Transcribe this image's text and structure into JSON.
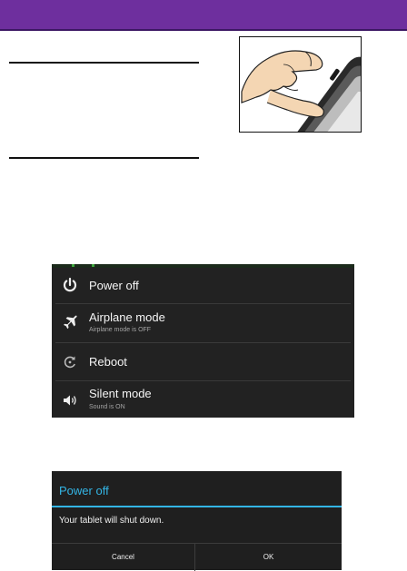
{
  "colors": {
    "header": "#6e2f9e",
    "menu_background": "#222222",
    "dialog_background": "#1f1f1f",
    "dialog_accent": "#33b5e5"
  },
  "power_menu": {
    "items": [
      {
        "title": "Power off",
        "subtitle": "",
        "icon": "power-icon"
      },
      {
        "title": "Airplane mode",
        "subtitle": "Airplane mode is OFF",
        "icon": "airplane-icon"
      },
      {
        "title": "Reboot",
        "subtitle": "",
        "icon": "reboot-icon"
      },
      {
        "title": "Silent mode",
        "subtitle": "Sound is ON",
        "icon": "speaker-icon"
      }
    ]
  },
  "dialog": {
    "title": "Power off",
    "message": "Your tablet will shut down.",
    "cancel_label": "Cancel",
    "ok_label": "OK"
  }
}
